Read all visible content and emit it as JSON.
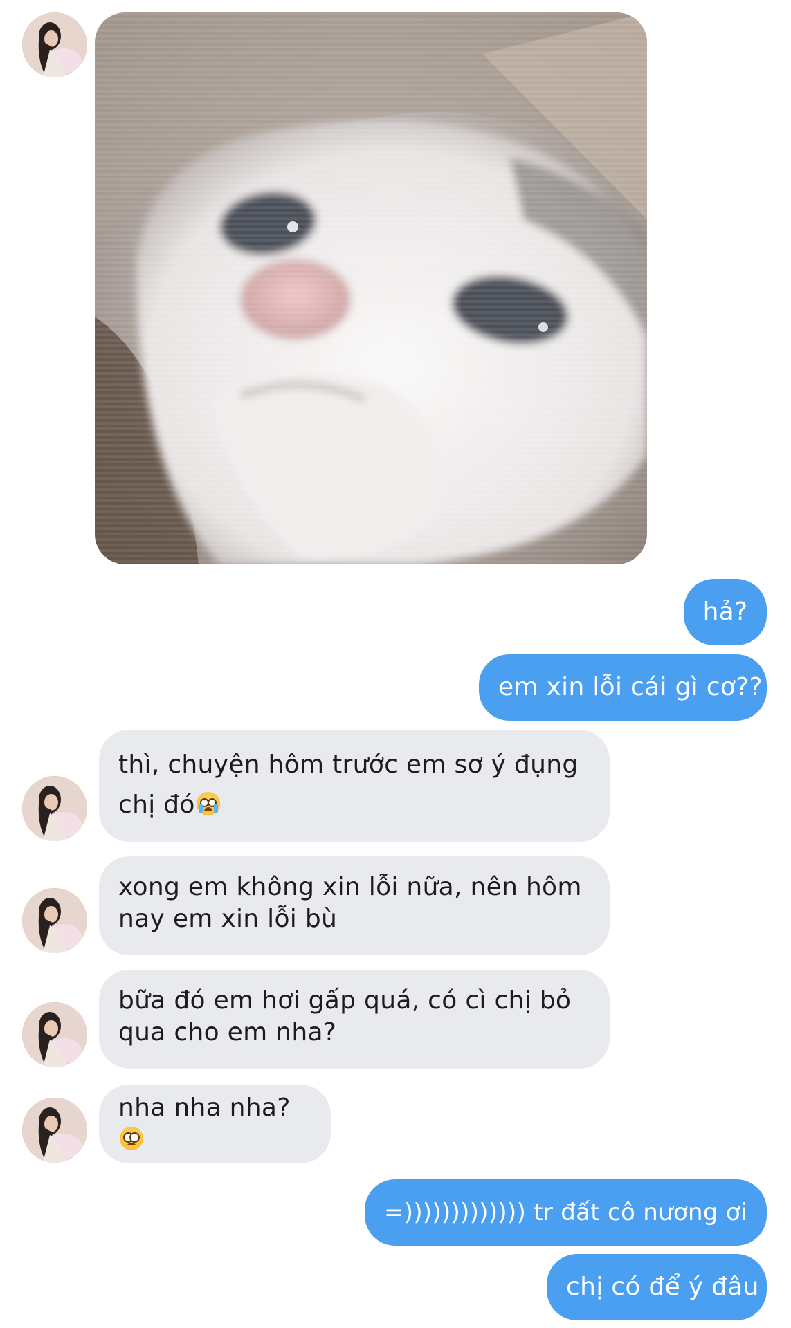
{
  "contact": {
    "avatar_icon": "profile-photo-avatar"
  },
  "attachment": {
    "icon": "crying-cat-photo",
    "colors": {
      "fur": "#f4f1f1",
      "nose": "#e8b3b4",
      "eyes": "#4b5058"
    }
  },
  "messages": [
    {
      "direction": "outgoing",
      "text": "hả?"
    },
    {
      "direction": "outgoing",
      "text": "em xin lỗi cái gì cơ??"
    },
    {
      "direction": "incoming",
      "lines": [
        "thì, chuyện hôm trước em sơ ý đụng",
        "chị đó"
      ],
      "emoji": "loudly-crying-face-emoji"
    },
    {
      "direction": "incoming",
      "lines": [
        "xong em không xin lỗi nữa, nên hôm",
        "nay em xin lỗi bù"
      ]
    },
    {
      "direction": "incoming",
      "lines": [
        "bữa đó em hơi gấp quá, có cì chị bỏ",
        "qua cho em nha?"
      ]
    },
    {
      "direction": "incoming",
      "lines": [
        "nha nha nha?"
      ],
      "emoji": "pleading-face-emoji"
    },
    {
      "direction": "outgoing",
      "text": "=))))))))))))) tr đất cô nương ơi"
    },
    {
      "direction": "outgoing",
      "text": "chị có để ý đâu"
    }
  ],
  "colors": {
    "outgoing_bubble": "#4a9ff0",
    "incoming_bubble": "#e9eaee",
    "outgoing_text": "#ffffff",
    "incoming_text": "#1c1c1e"
  }
}
